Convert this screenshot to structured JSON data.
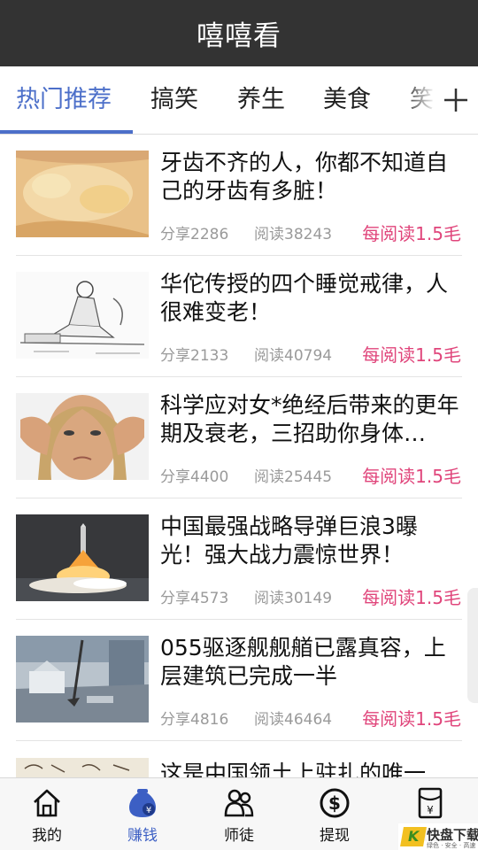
{
  "app": {
    "title": "嘻嘻看"
  },
  "tabs": [
    {
      "label": "热门推荐",
      "active": true
    },
    {
      "label": "搞笑",
      "active": false
    },
    {
      "label": "养生",
      "active": false
    },
    {
      "label": "美食",
      "active": false
    },
    {
      "label": "笑",
      "active": false
    }
  ],
  "tab_add_icon": "plus-icon",
  "accent_color": "#4c6fc9",
  "reward_color": "#e0457b",
  "articles": [
    {
      "title": "牙齿不齐的人，你都不知道自己的牙齿有多脏！",
      "share": "分享2286",
      "read": "阅读38243",
      "reward": "每阅读1.5毛"
    },
    {
      "title": "华佗传授的四个睡觉戒律，人很难变老！",
      "share": "分享2133",
      "read": "阅读40794",
      "reward": "每阅读1.5毛"
    },
    {
      "title": "科学应对女*绝经后带来的更年期及衰老，三招助你身体…",
      "share": "分享4400",
      "read": "阅读25445",
      "reward": "每阅读1.5毛"
    },
    {
      "title": "中国最强战略导弹巨浪3曝光！强大战力震惊世界！",
      "share": "分享4573",
      "read": "阅读30149",
      "reward": "每阅读1.5毛"
    },
    {
      "title": "055驱逐舰舰艏已露真容，上层建筑已完成一半",
      "share": "分享4816",
      "read": "阅读46464",
      "reward": "每阅读1.5毛"
    },
    {
      "title": "这是中国领土上驻扎的唯一"
    }
  ],
  "bottom_nav": [
    {
      "label": "我的",
      "icon": "home-icon",
      "active": false
    },
    {
      "label": "赚钱",
      "icon": "money-bag-icon",
      "active": true
    },
    {
      "label": "师徒",
      "icon": "people-icon",
      "active": false
    },
    {
      "label": "提现",
      "icon": "dollar-coin-icon",
      "active": false
    },
    {
      "label": "红包",
      "icon": "red-envelope-icon",
      "active": false
    }
  ],
  "watermark": {
    "badge": "K",
    "text": "快盘下载",
    "sub": "绿色 · 安全 · 高速"
  }
}
